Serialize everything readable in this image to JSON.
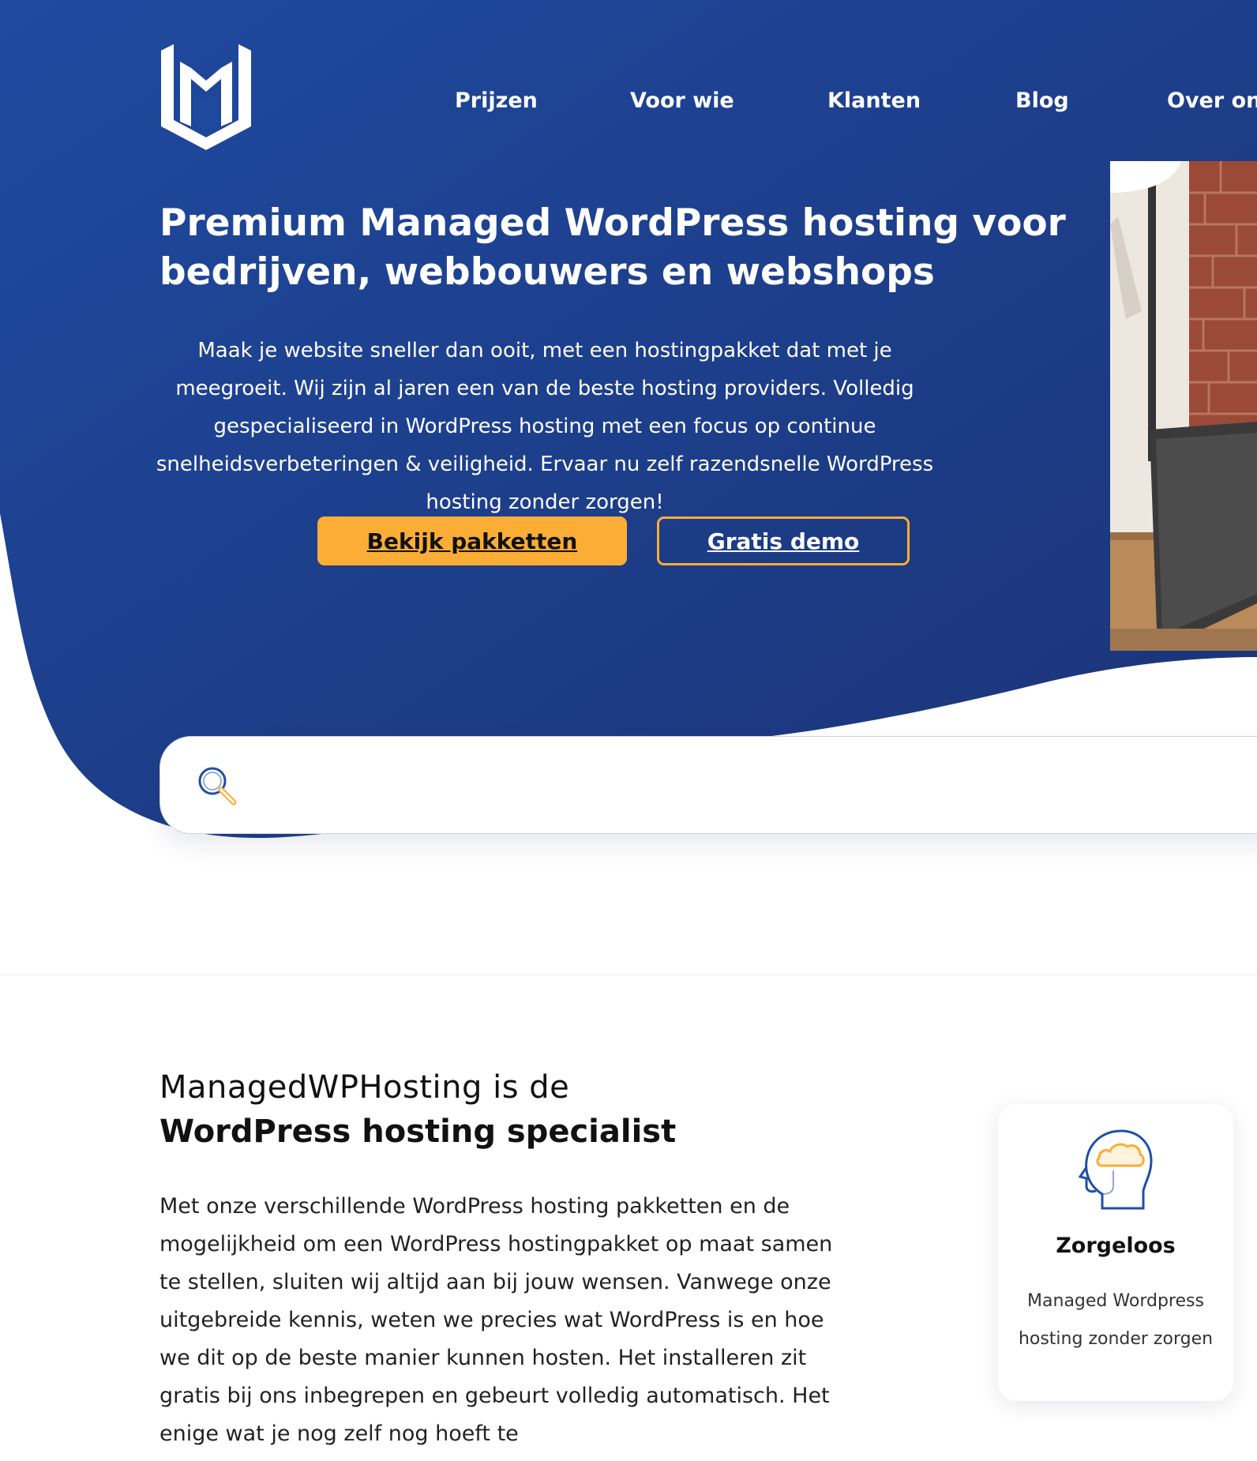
{
  "header": {
    "nav": [
      {
        "label": "Prijzen"
      },
      {
        "label": "Voor wie"
      },
      {
        "label": "Klanten"
      },
      {
        "label": "Blog"
      },
      {
        "label": "Over ons"
      }
    ]
  },
  "hero": {
    "title": "Premium Managed WordPress hosting voor bedrijven, webbouwers en webshops",
    "text": "Maak je website sneller dan ooit, met een hostingpakket dat met je meegroeit. Wij zijn al jaren een van de beste hosting providers. Volledig gespecialiseerd in WordPress hosting met een focus op continue snelheidsverbeteringen & veiligheid. Ervaar nu zelf razendsnelle WordPress hosting zonder zorgen!",
    "primary_button": "Bekijk pakketten",
    "secondary_button": "Gratis demo"
  },
  "search": {
    "icon": "search-icon",
    "value": "",
    "placeholder": ""
  },
  "intro": {
    "heading_light": "ManagedWPHosting is de",
    "heading_bold": "WordPress hosting specialist",
    "text": "Met onze verschillende WordPress hosting pakketten en de mogelijkheid om een WordPress hostingpakket op maat samen te stellen, sluiten wij altijd aan bij jouw wensen. Vanwege onze uitgebreide kennis, weten we precies wat WordPress is en hoe we dit op de beste manier kunnen hosten. Het installeren zit gratis bij ons inbegrepen en gebeurt volledig automatisch. Het enige wat je nog zelf nog hoeft te"
  },
  "feature_card": {
    "icon": "head-cloud-icon",
    "title": "Zorgeloos",
    "text": "Managed Wordpress hosting zonder zorgen"
  },
  "colors": {
    "hero_dark": "#1b3a82",
    "hero_light": "#1f4aa0",
    "accent": "#fbad35",
    "icon_blue": "#1f4fa6"
  }
}
